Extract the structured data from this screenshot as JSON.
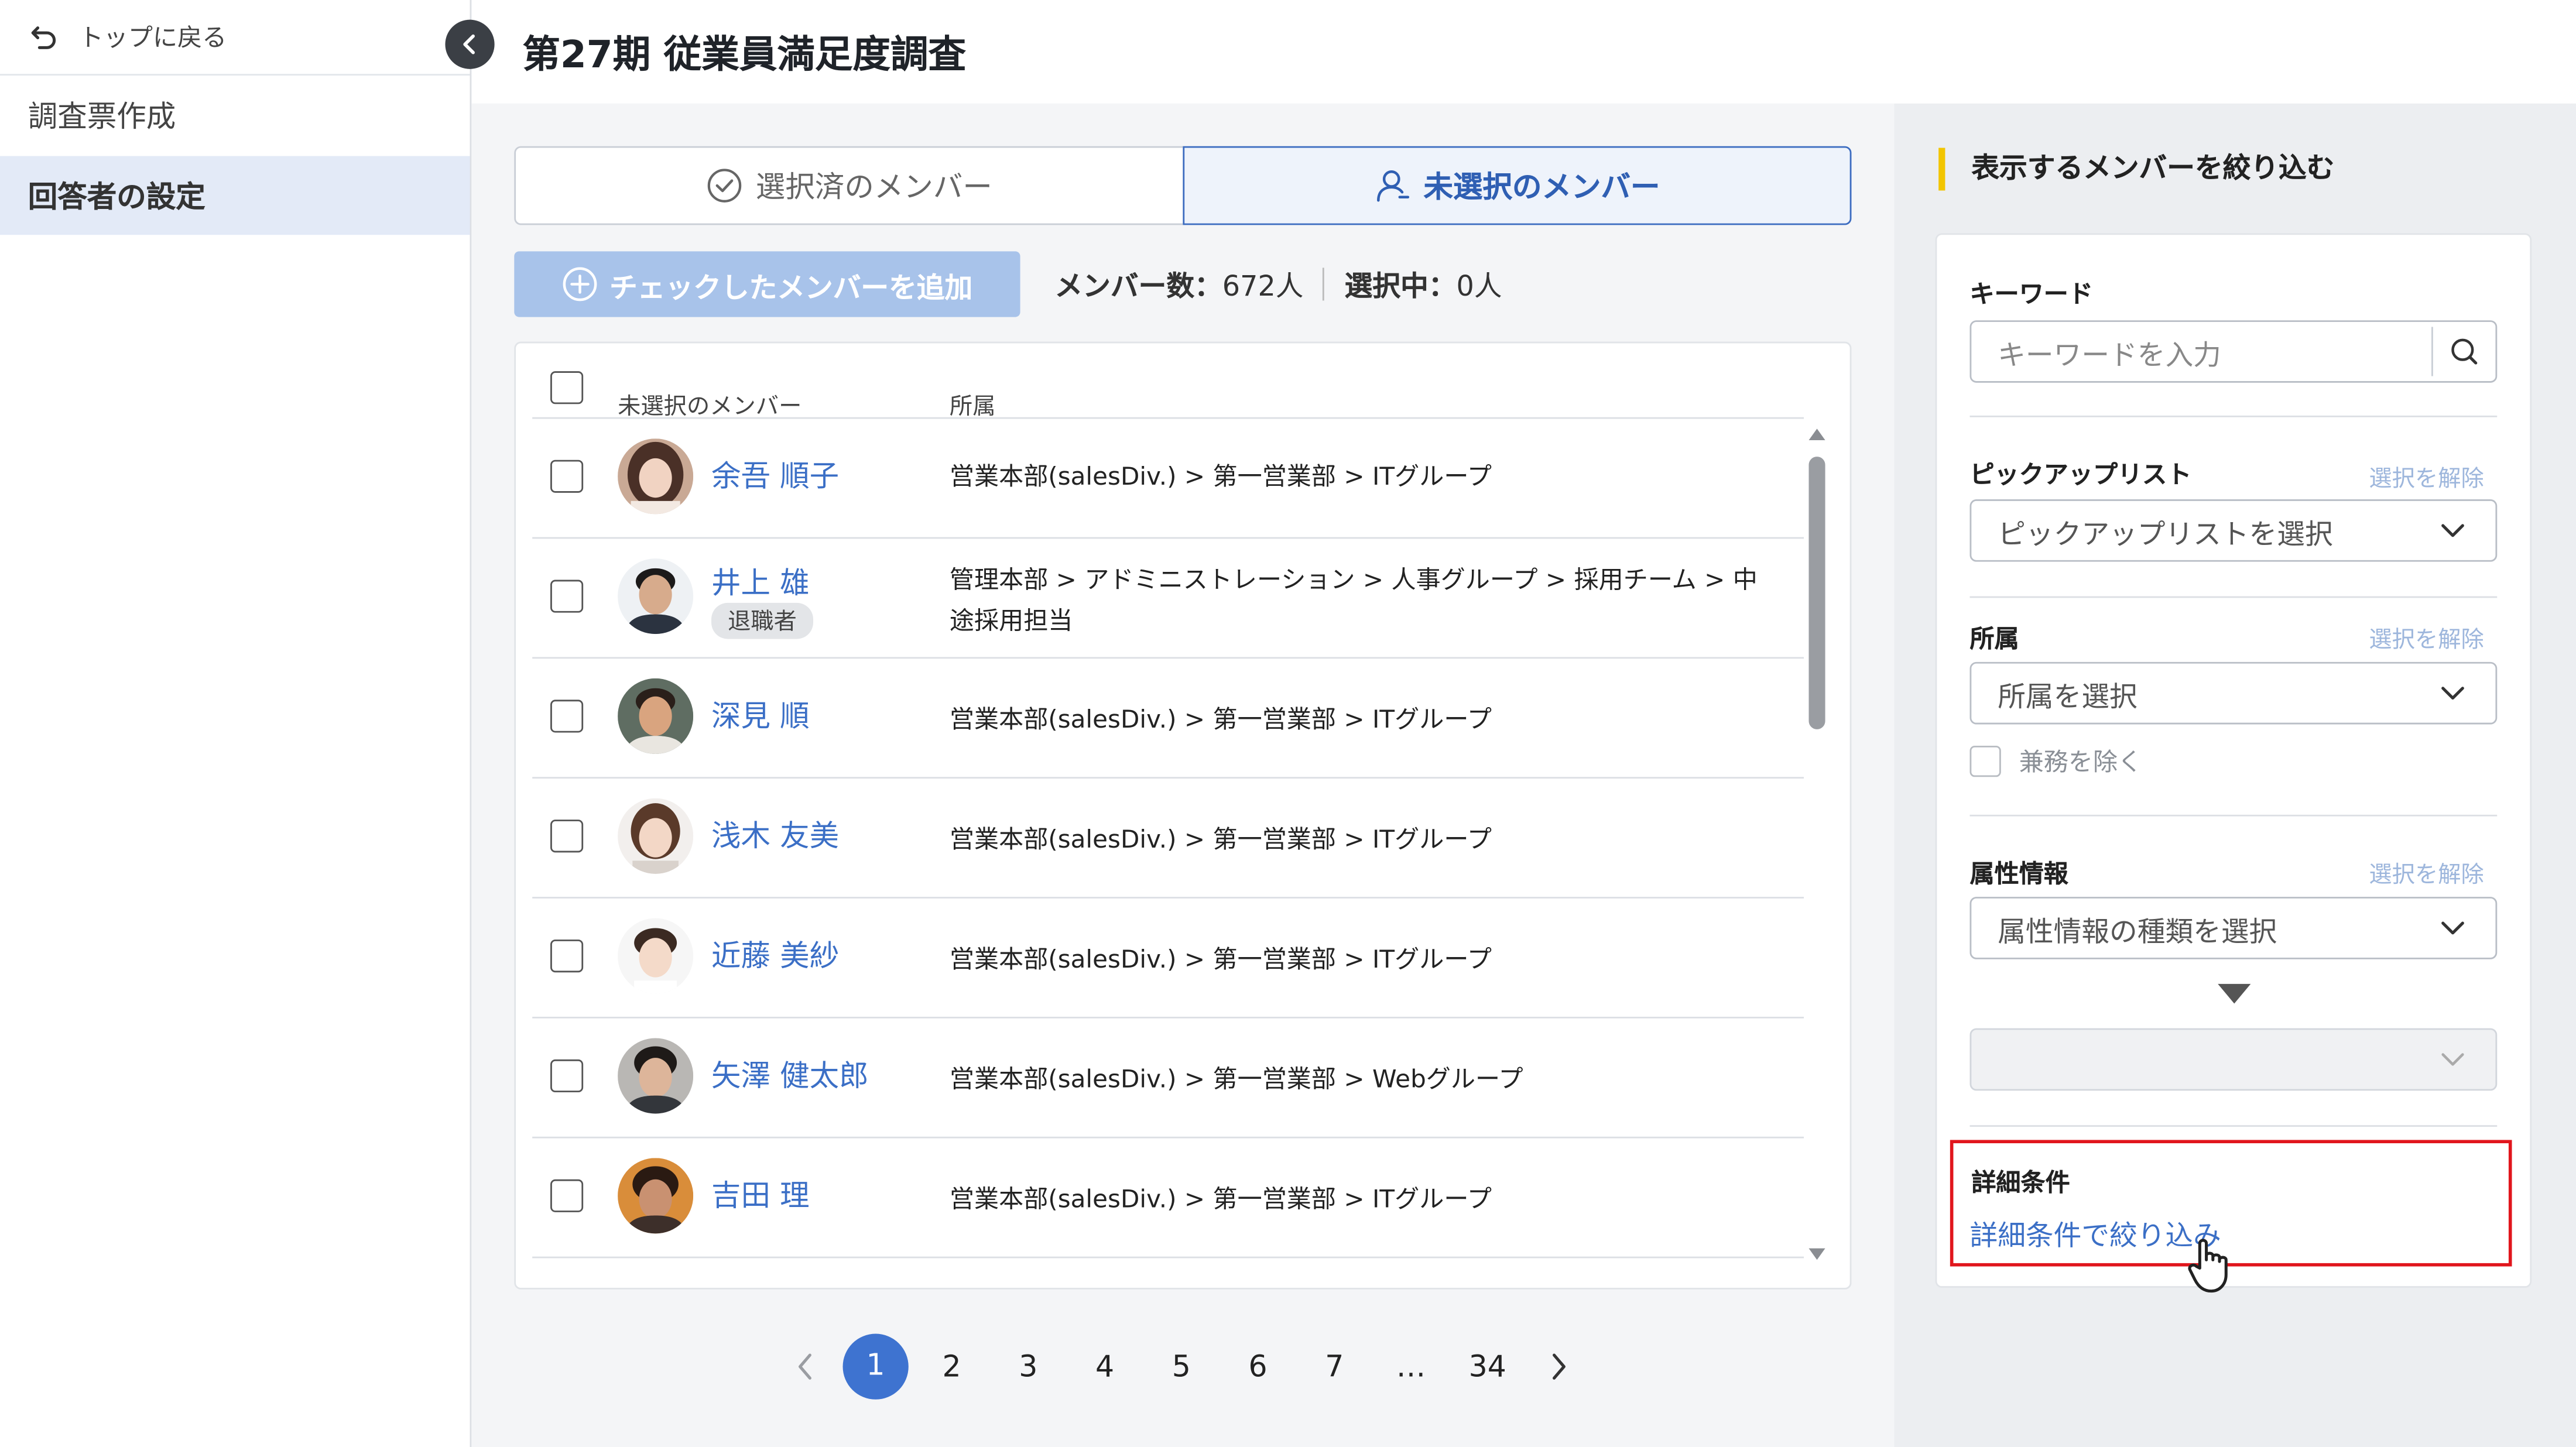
{
  "sidebar": {
    "back_label": "トップに戻る",
    "items": [
      {
        "label": "調査票作成",
        "active": false
      },
      {
        "label": "回答者の設定",
        "active": true
      }
    ]
  },
  "header": {
    "title": "第27期 従業員満足度調査"
  },
  "tabs": [
    {
      "label": "選択済のメンバー",
      "icon": "check-circle-icon",
      "active": false
    },
    {
      "label": "未選択のメンバー",
      "icon": "person-icon",
      "active": true
    }
  ],
  "toolbar": {
    "add_button_label": "チェックしたメンバーを追加",
    "member_count_label": "メンバー数：",
    "member_count_value": "672人",
    "selected_label": "選択中：",
    "selected_value": "0人"
  },
  "table": {
    "columns": [
      "未選択のメンバー",
      "所属"
    ],
    "rows": [
      {
        "name": "余吾 順子",
        "badge": "",
        "dept": "営業本部(salesDiv.) > 第一営業部 > ITグループ"
      },
      {
        "name": "井上 雄",
        "badge": "退職者",
        "dept": "管理本部 > アドミニストレーション > 人事グループ > 採用チーム > 中途採用担当"
      },
      {
        "name": "深見 順",
        "badge": "",
        "dept": "営業本部(salesDiv.) > 第一営業部 > ITグループ"
      },
      {
        "name": "浅木 友美",
        "badge": "",
        "dept": "営業本部(salesDiv.) > 第一営業部 > ITグループ"
      },
      {
        "name": "近藤 美紗",
        "badge": "",
        "dept": "営業本部(salesDiv.) > 第一営業部 > ITグループ"
      },
      {
        "name": "矢澤 健太郎",
        "badge": "",
        "dept": "営業本部(salesDiv.) > 第一営業部 > Webグループ"
      },
      {
        "name": "吉田 理",
        "badge": "",
        "dept": "営業本部(salesDiv.) > 第一営業部 > ITグループ"
      }
    ]
  },
  "pagination": {
    "pages": [
      "1",
      "2",
      "3",
      "4",
      "5",
      "6",
      "7",
      "…",
      "34"
    ],
    "current": "1"
  },
  "filter_panel": {
    "title": "表示するメンバーを絞り込む",
    "keyword": {
      "label": "キーワード",
      "placeholder": "キーワードを入力"
    },
    "pickup": {
      "label": "ピックアップリスト",
      "clear": "選択を解除",
      "placeholder": "ピックアップリストを選択"
    },
    "dept": {
      "label": "所属",
      "clear": "選択を解除",
      "placeholder": "所属を選択",
      "exclude_label": "兼務を除く"
    },
    "attribute": {
      "label": "属性情報",
      "clear": "選択を解除",
      "placeholder": "属性情報の種類を選択"
    },
    "detail": {
      "label": "詳細条件",
      "link": "詳細条件で絞り込み"
    }
  },
  "colors": {
    "accent": "#3e73d0",
    "link": "#3b6fc6",
    "highlight_box": "#e1161d",
    "title_bar": "#f2c500"
  }
}
